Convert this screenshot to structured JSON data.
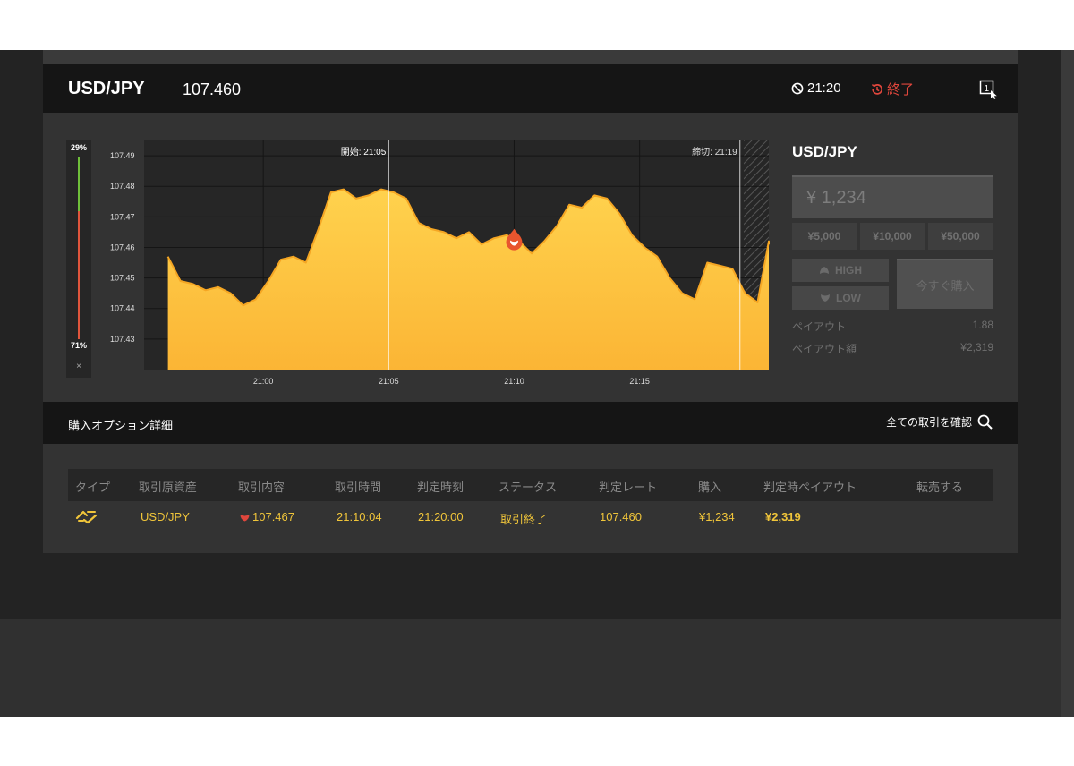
{
  "header": {
    "pair": "USD/JPY",
    "price": "107.460",
    "timer": "21:20",
    "status": "終了"
  },
  "gauge": {
    "high_percent": "29%",
    "low_percent": "71%",
    "close_glyph": "×"
  },
  "chart_data": {
    "type": "area",
    "x_ticks": [
      "21:00",
      "21:05",
      "21:10",
      "21:15"
    ],
    "y_ticks": [
      "107.49",
      "107.48",
      "107.47",
      "107.46",
      "107.45",
      "107.44",
      "107.43"
    ],
    "ylim": [
      107.42,
      107.495
    ],
    "start_label": "開始: 21:05",
    "end_label": "締切: 21:19",
    "x": [
      -3.8,
      -3.3,
      -2.8,
      -2.3,
      -1.8,
      -1.3,
      -0.8,
      -0.3,
      0.2,
      0.7,
      1.2,
      1.7,
      2.2,
      2.7,
      3.2,
      3.7,
      4.2,
      4.7,
      5.2,
      5.7,
      6.2,
      6.7,
      7.2,
      7.7,
      8.2,
      8.7,
      9.2,
      9.7,
      10.2,
      10.7,
      11.2,
      11.7,
      12.2,
      12.7,
      13.2,
      13.7,
      14.2,
      14.7,
      15.2,
      15.7,
      16.2,
      16.7,
      17.2,
      17.7,
      18.2,
      18.7,
      19.2,
      19.7,
      20.2,
      20.8
    ],
    "values": [
      107.457,
      107.449,
      107.448,
      107.446,
      107.447,
      107.445,
      107.441,
      107.443,
      107.449,
      107.456,
      107.457,
      107.455,
      107.466,
      107.478,
      107.479,
      107.476,
      107.477,
      107.479,
      107.478,
      107.476,
      107.468,
      107.466,
      107.465,
      107.463,
      107.465,
      107.461,
      107.463,
      107.464,
      107.462,
      107.458,
      107.462,
      107.467,
      107.474,
      107.473,
      107.477,
      107.476,
      107.471,
      107.464,
      107.46,
      107.457,
      107.45,
      107.445,
      107.443,
      107.455,
      107.454,
      107.453,
      107.445,
      107.442,
      107.462,
      107.461
    ],
    "entry_marker": {
      "x": 10.0,
      "y": 107.462
    },
    "fill_color": "#fbbf3c",
    "line_color": "#f5a623"
  },
  "order": {
    "pair": "USD/JPY",
    "amount_placeholder": "¥ 1,234",
    "presets": [
      "¥5,000",
      "¥10,000",
      "¥50,000"
    ],
    "high_label": "HIGH",
    "low_label": "LOW",
    "buy_label": "今すぐ購入",
    "payout_label": "ペイアウト",
    "payout_value": "1.88",
    "payout_amount_label": "ペイアウト額",
    "payout_amount_value": "¥2,319"
  },
  "options": {
    "title": "購入オプション詳細",
    "view_all": "全ての取引を確認"
  },
  "table": {
    "headers": [
      "タイプ",
      "取引原資産",
      "取引内容",
      "取引時間",
      "判定時刻",
      "ステータス",
      "判定レート",
      "購入",
      "判定時ペイアウト",
      "転売する"
    ],
    "row": {
      "asset": "USD/JPY",
      "content": "107.467",
      "trade_time": "21:10:04",
      "judge_time": "21:20:00",
      "status": "取引終了",
      "judge_rate": "107.460",
      "purchase": "¥1,234",
      "payout": "¥2,319"
    }
  },
  "colors": {
    "accent_yellow": "#f0c53a",
    "alert_red": "#e0463c",
    "gauge_green": "#6fbf3a"
  }
}
